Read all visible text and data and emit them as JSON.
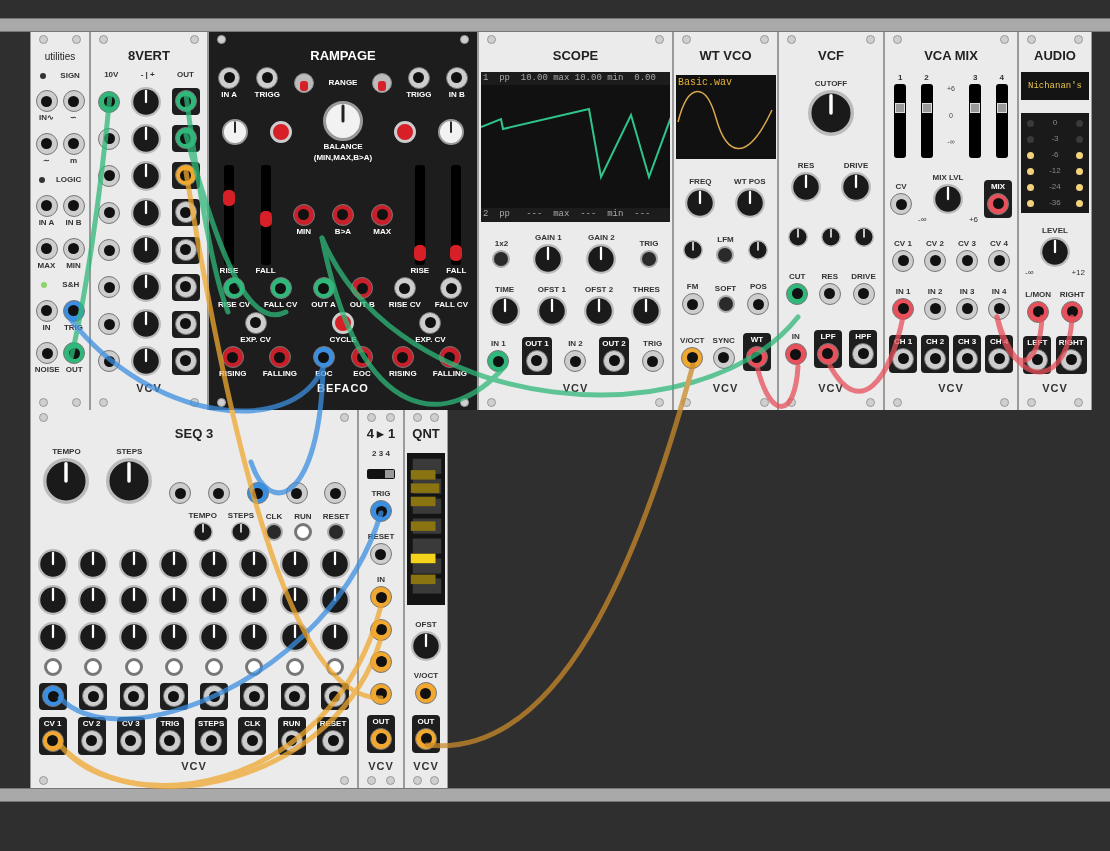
{
  "rows": [
    {
      "modules": [
        {
          "title": "utilities",
          "dark": false,
          "controls": [
            {
              "items": [
                {
                  "kind": "led",
                  "on": false
                },
                {
                  "kind": "text",
                  "label": "SIGN"
                }
              ]
            },
            {
              "items": [
                {
                  "kind": "jack",
                  "label": "IN∿"
                },
                {
                  "kind": "jack",
                  "label": "∽"
                }
              ]
            },
            {
              "items": [
                {
                  "kind": "jack",
                  "label": "∼"
                },
                {
                  "kind": "jack",
                  "label": "m"
                }
              ]
            },
            {
              "items": [
                {
                  "kind": "led",
                  "on": false
                },
                {
                  "kind": "text",
                  "label": "LOGIC"
                }
              ]
            },
            {
              "items": [
                {
                  "kind": "jack",
                  "label": "IN A"
                },
                {
                  "kind": "jack",
                  "label": "IN B"
                }
              ]
            },
            {
              "items": [
                {
                  "kind": "jack",
                  "label": "MAX"
                },
                {
                  "kind": "jack",
                  "label": "MIN"
                }
              ]
            },
            {
              "items": [
                {
                  "kind": "led",
                  "on": true
                },
                {
                  "kind": "text",
                  "label": "S&H"
                }
              ]
            },
            {
              "items": [
                {
                  "kind": "jack",
                  "label": "IN"
                },
                {
                  "kind": "jack",
                  "label": "TRIG",
                  "color": "#3b8fe0"
                }
              ]
            },
            {
              "items": [
                {
                  "kind": "jack",
                  "label": "NOISE"
                },
                {
                  "kind": "jack",
                  "label": "OUT",
                  "color": "#2fb87a"
                }
              ]
            }
          ]
        },
        {
          "title": "8VERT",
          "dark": false,
          "brand": "VCV",
          "controls": [
            {
              "items": [
                {
                  "kind": "text",
                  "label": "10V"
                },
                {
                  "kind": "text",
                  "label": "- | +"
                },
                {
                  "kind": "text",
                  "label": "OUT"
                }
              ]
            },
            {
              "items": [
                {
                  "kind": "jack",
                  "color": "#2fb87a"
                },
                {
                  "kind": "knob"
                },
                {
                  "kind": "out",
                  "color": "#2fb87a"
                }
              ]
            },
            {
              "items": [
                {
                  "kind": "jack"
                },
                {
                  "kind": "knob"
                },
                {
                  "kind": "out",
                  "color": "#2fb87a"
                }
              ]
            },
            {
              "items": [
                {
                  "kind": "jack"
                },
                {
                  "kind": "knob"
                },
                {
                  "kind": "out",
                  "color": "#f0a830"
                }
              ]
            },
            {
              "items": [
                {
                  "kind": "jack"
                },
                {
                  "kind": "knob"
                },
                {
                  "kind": "out"
                }
              ]
            },
            {
              "items": [
                {
                  "kind": "jack"
                },
                {
                  "kind": "knob"
                },
                {
                  "kind": "out"
                }
              ]
            },
            {
              "items": [
                {
                  "kind": "jack"
                },
                {
                  "kind": "knob"
                },
                {
                  "kind": "out"
                }
              ]
            },
            {
              "items": [
                {
                  "kind": "jack"
                },
                {
                  "kind": "knob"
                },
                {
                  "kind": "out"
                }
              ]
            },
            {
              "items": [
                {
                  "kind": "jack"
                },
                {
                  "kind": "knob"
                },
                {
                  "kind": "out"
                }
              ]
            }
          ]
        },
        {
          "title": "RAMPAGE",
          "dark": true,
          "brand": "BEFACO",
          "controls": [
            {
              "items": [
                {
                  "kind": "jack",
                  "label": "IN A"
                },
                {
                  "kind": "jack",
                  "label": "TRIGG"
                },
                {
                  "kind": "toggle",
                  "on": true
                },
                {
                  "kind": "text",
                  "label": "RANGE"
                },
                {
                  "kind": "toggle",
                  "on": true
                },
                {
                  "kind": "jack",
                  "label": "TRIGG"
                },
                {
                  "kind": "jack",
                  "label": "IN B"
                }
              ]
            },
            {
              "items": [
                {
                  "kind": "wknob"
                },
                {
                  "kind": "red"
                },
                {
                  "kind": "bigw",
                  "label": "BALANCE",
                  "note": "(MIN,MAX,B>A)"
                },
                {
                  "kind": "red"
                },
                {
                  "kind": "wknob"
                }
              ]
            },
            {
              "items": [
                {
                  "kind": "slider",
                  "label": "RISE",
                  "level": 0.7
                },
                {
                  "kind": "slider",
                  "label": "FALL",
                  "level": 0.45
                },
                {
                  "kind": "rjack",
                  "label": "MIN"
                },
                {
                  "kind": "rjack",
                  "label": "B>A"
                },
                {
                  "kind": "rjack",
                  "label": "MAX"
                },
                {
                  "kind": "slider",
                  "label": "RISE",
                  "level": 0.05
                },
                {
                  "kind": "slider",
                  "label": "FALL",
                  "level": 0.05
                }
              ]
            },
            {
              "items": [
                {
                  "kind": "jack",
                  "label": "RISE CV",
                  "color": "#2fb87a"
                },
                {
                  "kind": "jack",
                  "label": "FALL CV",
                  "color": "#2fb87a"
                },
                {
                  "kind": "rjack",
                  "label": "OUT A",
                  "color": "#2fb87a"
                },
                {
                  "kind": "rjack",
                  "label": "OUT B"
                },
                {
                  "kind": "jack",
                  "label": "RISE CV"
                },
                {
                  "kind": "jack",
                  "label": "FALL CV"
                }
              ]
            },
            {
              "items": [
                {
                  "kind": "jack",
                  "label": "EXP. CV"
                },
                {
                  "kind": "red",
                  "label": "CYCLE"
                },
                {
                  "kind": "jack",
                  "label": "EXP. CV"
                }
              ]
            },
            {
              "items": [
                {
                  "kind": "rjack",
                  "label": "RISING"
                },
                {
                  "kind": "rjack",
                  "label": "FALLING"
                },
                {
                  "kind": "rjack",
                  "label": "EOC",
                  "color": "#3b8fe0"
                },
                {
                  "kind": "rjack",
                  "label": "EOC"
                },
                {
                  "kind": "rjack",
                  "label": "RISING"
                },
                {
                  "kind": "rjack",
                  "label": "FALLING"
                }
              ]
            }
          ]
        },
        {
          "title": "SCOPE",
          "dark": false,
          "brand": "VCV",
          "controls": [
            {
              "items": [
                {
                  "kind": "scope",
                  "lines": [
                    "1  pp  10.00 max 10.00 min  0.00",
                    "2  pp   ---  max  ---  min  ---"
                  ]
                }
              ]
            },
            {
              "items": [
                {
                  "kind": "button",
                  "label": "1x2"
                },
                {
                  "kind": "knob",
                  "label": "GAIN 1"
                },
                {
                  "kind": "knob",
                  "label": "GAIN 2"
                },
                {
                  "kind": "button",
                  "label": "TRIG"
                }
              ]
            },
            {
              "items": [
                {
                  "kind": "knob",
                  "label": "TIME"
                },
                {
                  "kind": "knob",
                  "label": "OFST 1"
                },
                {
                  "kind": "knob",
                  "label": "OFST 2"
                },
                {
                  "kind": "knob",
                  "label": "THRES"
                }
              ]
            },
            {
              "items": [
                {
                  "kind": "jack",
                  "label": "IN 1",
                  "color": "#2fb87a"
                },
                {
                  "kind": "out",
                  "label": "OUT 1"
                },
                {
                  "kind": "jack",
                  "label": "IN 2"
                },
                {
                  "kind": "out",
                  "label": "OUT 2"
                },
                {
                  "kind": "jack",
                  "label": "TRIG"
                }
              ]
            }
          ]
        },
        {
          "title": "WT VCO",
          "dark": false,
          "brand": "VCV",
          "controls": [
            {
              "items": [
                {
                  "kind": "wt",
                  "label": "Basic.wav"
                }
              ]
            },
            {
              "items": [
                {
                  "kind": "knob",
                  "label": "FREQ"
                },
                {
                  "kind": "knob",
                  "label": "WT POS"
                }
              ]
            },
            {
              "items": [
                {
                  "kind": "small"
                },
                {
                  "kind": "button",
                  "label": "LFM"
                },
                {
                  "kind": "small"
                }
              ]
            },
            {
              "items": [
                {
                  "kind": "jack",
                  "label": "FM"
                },
                {
                  "kind": "button",
                  "label": "SOFT"
                },
                {
                  "kind": "jack",
                  "label": "POS"
                }
              ]
            },
            {
              "items": [
                {
                  "kind": "jack",
                  "label": "V/OCT",
                  "color": "#f0a830"
                },
                {
                  "kind": "jack",
                  "label": "SYNC"
                },
                {
                  "kind": "out",
                  "label": "WT",
                  "color": "#e8505b"
                }
              ]
            }
          ]
        },
        {
          "title": "VCF",
          "dark": false,
          "brand": "VCV",
          "controls": [
            {
              "items": [
                {
                  "kind": "big",
                  "label": "CUTOFF"
                }
              ]
            },
            {
              "items": [
                {
                  "kind": "knob",
                  "label": "RES"
                },
                {
                  "kind": "knob",
                  "label": "DRIVE"
                }
              ]
            },
            {
              "items": [
                {
                  "kind": "small"
                },
                {
                  "kind": "small"
                },
                {
                  "kind": "small"
                }
              ]
            },
            {
              "items": [
                {
                  "kind": "jack",
                  "label": "CUT",
                  "color": "#2fb87a"
                },
                {
                  "kind": "jack",
                  "label": "RES"
                },
                {
                  "kind": "jack",
                  "label": "DRIVE"
                }
              ]
            },
            {
              "items": [
                {
                  "kind": "jack",
                  "label": "IN",
                  "color": "#e8505b"
                },
                {
                  "kind": "out",
                  "label": "LPF",
                  "color": "#e8505b"
                },
                {
                  "kind": "out",
                  "label": "HPF"
                }
              ]
            }
          ]
        },
        {
          "title": "VCA MIX",
          "dark": false,
          "brand": "VCV",
          "controls": [
            {
              "items": [
                {
                  "kind": "fader",
                  "label": "1",
                  "level": 0.7
                },
                {
                  "kind": "fader",
                  "label": "2",
                  "level": 0.7
                },
                {
                  "kind": "scale",
                  "ticks": [
                    "+6",
                    "0",
                    "-∞"
                  ]
                },
                {
                  "kind": "fader",
                  "label": "3",
                  "level": 0.7
                },
                {
                  "kind": "fader",
                  "label": "4",
                  "level": 0.7
                }
              ]
            },
            {
              "items": [
                {
                  "kind": "jack",
                  "label": "CV"
                },
                {
                  "kind": "knob",
                  "label": "MIX LVL",
                  "min": "-∞",
                  "max": "+6"
                },
                {
                  "kind": "out",
                  "label": "MIX",
                  "color": "#e8505b"
                }
              ]
            },
            {
              "items": [
                {
                  "kind": "jack",
                  "label": "CV 1"
                },
                {
                  "kind": "jack",
                  "label": "CV 2"
                },
                {
                  "kind": "jack",
                  "label": "CV 3"
                },
                {
                  "kind": "jack",
                  "label": "CV 4"
                }
              ]
            },
            {
              "items": [
                {
                  "kind": "jack",
                  "label": "IN 1",
                  "color": "#e8505b"
                },
                {
                  "kind": "jack",
                  "label": "IN 2"
                },
                {
                  "kind": "jack",
                  "label": "IN 3"
                },
                {
                  "kind": "jack",
                  "label": "IN 4"
                }
              ]
            },
            {
              "items": [
                {
                  "kind": "out",
                  "label": "CH 1"
                },
                {
                  "kind": "out",
                  "label": "CH 2"
                },
                {
                  "kind": "out",
                  "label": "CH 3"
                },
                {
                  "kind": "out",
                  "label": "CH 4"
                }
              ]
            }
          ]
        },
        {
          "title": "AUDIO",
          "dark": false,
          "brand": "VCV",
          "controls": [
            {
              "items": [
                {
                  "kind": "screen",
                  "label": "Nichanan's"
                }
              ]
            },
            {
              "items": [
                {
                  "kind": "meter",
                  "ticks": [
                    {
                      "label": "0",
                      "on": false
                    },
                    {
                      "label": "-3",
                      "on": false
                    },
                    {
                      "label": "-6",
                      "on": true
                    },
                    {
                      "label": "-12",
                      "on": true
                    },
                    {
                      "label": "-24",
                      "on": true
                    },
                    {
                      "label": "-36",
                      "on": true
                    }
                  ]
                }
              ]
            },
            {
              "items": [
                {
                  "kind": "knob",
                  "label": "LEVEL",
                  "min": "-∞",
                  "max": "+12"
                }
              ]
            },
            {
              "items": [
                {
                  "kind": "jack",
                  "label": "L/MON",
                  "color": "#e8505b"
                },
                {
                  "kind": "jack",
                  "label": "RIGHT",
                  "color": "#e8505b"
                }
              ]
            },
            {
              "items": [
                {
                  "kind": "out",
                  "label": "LEFT"
                },
                {
                  "kind": "out",
                  "label": "RIGHT"
                }
              ]
            }
          ]
        }
      ]
    },
    {
      "modules": [
        {
          "title": "SEQ 3",
          "dark": false,
          "brand": "VCV",
          "controls": [
            {
              "items": [
                {
                  "kind": "big",
                  "label": "TEMPO"
                },
                {
                  "kind": "big",
                  "label": "STEPS"
                },
                {
                  "kind": "jack"
                },
                {
                  "kind": "jack"
                },
                {
                  "kind": "jack",
                  "color": "#3b8fe0"
                },
                {
                  "kind": "jack"
                },
                {
                  "kind": "jack"
                }
              ]
            },
            {
              "items": [
                {
                  "kind": "small",
                  "label": "TEMPO"
                },
                {
                  "kind": "small",
                  "label": "STEPS"
                },
                {
                  "kind": "button",
                  "label": "CLK"
                },
                {
                  "kind": "white",
                  "label": "RUN",
                  "on": true
                },
                {
                  "kind": "button",
                  "label": "RESET"
                }
              ]
            },
            {
              "items": [
                {
                  "kind": "knob"
                },
                {
                  "kind": "knob"
                },
                {
                  "kind": "knob"
                },
                {
                  "kind": "knob"
                },
                {
                  "kind": "knob"
                },
                {
                  "kind": "knob"
                },
                {
                  "kind": "knob"
                },
                {
                  "kind": "knob"
                }
              ]
            },
            {
              "items": [
                {
                  "kind": "knob"
                },
                {
                  "kind": "knob"
                },
                {
                  "kind": "knob"
                },
                {
                  "kind": "knob"
                },
                {
                  "kind": "knob"
                },
                {
                  "kind": "knob"
                },
                {
                  "kind": "knob"
                },
                {
                  "kind": "knob"
                }
              ]
            },
            {
              "items": [
                {
                  "kind": "knob"
                },
                {
                  "kind": "knob"
                },
                {
                  "kind": "knob"
                },
                {
                  "kind": "knob"
                },
                {
                  "kind": "knob"
                },
                {
                  "kind": "knob"
                },
                {
                  "kind": "knob"
                },
                {
                  "kind": "knob"
                }
              ]
            },
            {
              "items": [
                {
                  "kind": "white",
                  "on": true
                },
                {
                  "kind": "white",
                  "on": true
                },
                {
                  "kind": "white",
                  "on": true
                },
                {
                  "kind": "white",
                  "on": true
                },
                {
                  "kind": "white",
                  "on": true
                },
                {
                  "kind": "white",
                  "on": true
                },
                {
                  "kind": "white",
                  "on": true
                },
                {
                  "kind": "white",
                  "on": true
                }
              ]
            },
            {
              "items": [
                {
                  "kind": "out",
                  "color": "#3b8fe0"
                },
                {
                  "kind": "out"
                },
                {
                  "kind": "out"
                },
                {
                  "kind": "out"
                },
                {
                  "kind": "out"
                },
                {
                  "kind": "out"
                },
                {
                  "kind": "out"
                },
                {
                  "kind": "out"
                }
              ]
            },
            {
              "items": [
                {
                  "kind": "out",
                  "label": "CV 1",
                  "color": "#f0a830"
                },
                {
                  "kind": "out",
                  "label": "CV 2"
                },
                {
                  "kind": "out",
                  "label": "CV 3"
                },
                {
                  "kind": "out",
                  "label": "TRIG"
                },
                {
                  "kind": "out",
                  "label": "STEPS"
                },
                {
                  "kind": "out",
                  "label": "CLK"
                },
                {
                  "kind": "out",
                  "label": "RUN"
                },
                {
                  "kind": "out",
                  "label": "RESET"
                }
              ]
            }
          ]
        },
        {
          "title": "4 ▸ 1",
          "dark": false,
          "brand": "VCV",
          "controls": [
            {
              "items": [
                {
                  "kind": "text",
                  "label": "2 3 4"
                }
              ]
            },
            {
              "items": [
                {
                  "kind": "slide",
                  "on": true
                }
              ]
            },
            {
              "items": [
                {
                  "kind": "jack",
                  "label": "TRIG",
                  "color": "#3b8fe0"
                }
              ]
            },
            {
              "items": [
                {
                  "kind": "jack",
                  "label": "RESET"
                }
              ]
            },
            {
              "items": [
                {
                  "kind": "jack",
                  "label": "IN",
                  "color": "#f0a830"
                }
              ]
            },
            {
              "items": [
                {
                  "kind": "jack",
                  "color": "#f0a830"
                }
              ]
            },
            {
              "items": [
                {
                  "kind": "jack",
                  "color": "#f0a830"
                }
              ]
            },
            {
              "items": [
                {
                  "kind": "jack",
                  "color": "#f0a830"
                }
              ]
            },
            {
              "items": [
                {
                  "kind": "out",
                  "label": "OUT",
                  "color": "#f0a830"
                }
              ]
            }
          ]
        },
        {
          "title": "QNT",
          "dark": false,
          "brand": "VCV",
          "controls": [
            {
              "items": [
                {
                  "kind": "keys"
                }
              ]
            },
            {
              "items": [
                {
                  "kind": "knob",
                  "label": "OFST"
                }
              ]
            },
            {
              "items": [
                {
                  "kind": "jack",
                  "label": "V/OCT",
                  "color": "#f0a830"
                }
              ]
            },
            {
              "items": [
                {
                  "kind": "out",
                  "label": "OUT",
                  "color": "#f0a830"
                }
              ]
            }
          ]
        }
      ]
    }
  ]
}
